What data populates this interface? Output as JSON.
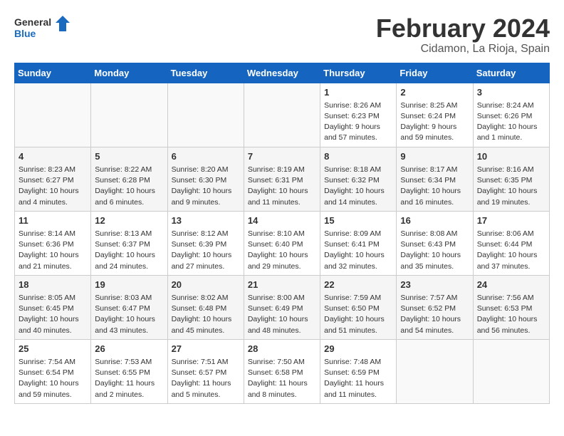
{
  "header": {
    "logo_general": "General",
    "logo_blue": "Blue",
    "month_title": "February 2024",
    "location": "Cidamon, La Rioja, Spain"
  },
  "weekdays": [
    "Sunday",
    "Monday",
    "Tuesday",
    "Wednesday",
    "Thursday",
    "Friday",
    "Saturday"
  ],
  "weeks": [
    [
      {
        "day": "",
        "info": ""
      },
      {
        "day": "",
        "info": ""
      },
      {
        "day": "",
        "info": ""
      },
      {
        "day": "",
        "info": ""
      },
      {
        "day": "1",
        "info": "Sunrise: 8:26 AM\nSunset: 6:23 PM\nDaylight: 9 hours\nand 57 minutes."
      },
      {
        "day": "2",
        "info": "Sunrise: 8:25 AM\nSunset: 6:24 PM\nDaylight: 9 hours\nand 59 minutes."
      },
      {
        "day": "3",
        "info": "Sunrise: 8:24 AM\nSunset: 6:26 PM\nDaylight: 10 hours\nand 1 minute."
      }
    ],
    [
      {
        "day": "4",
        "info": "Sunrise: 8:23 AM\nSunset: 6:27 PM\nDaylight: 10 hours\nand 4 minutes."
      },
      {
        "day": "5",
        "info": "Sunrise: 8:22 AM\nSunset: 6:28 PM\nDaylight: 10 hours\nand 6 minutes."
      },
      {
        "day": "6",
        "info": "Sunrise: 8:20 AM\nSunset: 6:30 PM\nDaylight: 10 hours\nand 9 minutes."
      },
      {
        "day": "7",
        "info": "Sunrise: 8:19 AM\nSunset: 6:31 PM\nDaylight: 10 hours\nand 11 minutes."
      },
      {
        "day": "8",
        "info": "Sunrise: 8:18 AM\nSunset: 6:32 PM\nDaylight: 10 hours\nand 14 minutes."
      },
      {
        "day": "9",
        "info": "Sunrise: 8:17 AM\nSunset: 6:34 PM\nDaylight: 10 hours\nand 16 minutes."
      },
      {
        "day": "10",
        "info": "Sunrise: 8:16 AM\nSunset: 6:35 PM\nDaylight: 10 hours\nand 19 minutes."
      }
    ],
    [
      {
        "day": "11",
        "info": "Sunrise: 8:14 AM\nSunset: 6:36 PM\nDaylight: 10 hours\nand 21 minutes."
      },
      {
        "day": "12",
        "info": "Sunrise: 8:13 AM\nSunset: 6:37 PM\nDaylight: 10 hours\nand 24 minutes."
      },
      {
        "day": "13",
        "info": "Sunrise: 8:12 AM\nSunset: 6:39 PM\nDaylight: 10 hours\nand 27 minutes."
      },
      {
        "day": "14",
        "info": "Sunrise: 8:10 AM\nSunset: 6:40 PM\nDaylight: 10 hours\nand 29 minutes."
      },
      {
        "day": "15",
        "info": "Sunrise: 8:09 AM\nSunset: 6:41 PM\nDaylight: 10 hours\nand 32 minutes."
      },
      {
        "day": "16",
        "info": "Sunrise: 8:08 AM\nSunset: 6:43 PM\nDaylight: 10 hours\nand 35 minutes."
      },
      {
        "day": "17",
        "info": "Sunrise: 8:06 AM\nSunset: 6:44 PM\nDaylight: 10 hours\nand 37 minutes."
      }
    ],
    [
      {
        "day": "18",
        "info": "Sunrise: 8:05 AM\nSunset: 6:45 PM\nDaylight: 10 hours\nand 40 minutes."
      },
      {
        "day": "19",
        "info": "Sunrise: 8:03 AM\nSunset: 6:47 PM\nDaylight: 10 hours\nand 43 minutes."
      },
      {
        "day": "20",
        "info": "Sunrise: 8:02 AM\nSunset: 6:48 PM\nDaylight: 10 hours\nand 45 minutes."
      },
      {
        "day": "21",
        "info": "Sunrise: 8:00 AM\nSunset: 6:49 PM\nDaylight: 10 hours\nand 48 minutes."
      },
      {
        "day": "22",
        "info": "Sunrise: 7:59 AM\nSunset: 6:50 PM\nDaylight: 10 hours\nand 51 minutes."
      },
      {
        "day": "23",
        "info": "Sunrise: 7:57 AM\nSunset: 6:52 PM\nDaylight: 10 hours\nand 54 minutes."
      },
      {
        "day": "24",
        "info": "Sunrise: 7:56 AM\nSunset: 6:53 PM\nDaylight: 10 hours\nand 56 minutes."
      }
    ],
    [
      {
        "day": "25",
        "info": "Sunrise: 7:54 AM\nSunset: 6:54 PM\nDaylight: 10 hours\nand 59 minutes."
      },
      {
        "day": "26",
        "info": "Sunrise: 7:53 AM\nSunset: 6:55 PM\nDaylight: 11 hours\nand 2 minutes."
      },
      {
        "day": "27",
        "info": "Sunrise: 7:51 AM\nSunset: 6:57 PM\nDaylight: 11 hours\nand 5 minutes."
      },
      {
        "day": "28",
        "info": "Sunrise: 7:50 AM\nSunset: 6:58 PM\nDaylight: 11 hours\nand 8 minutes."
      },
      {
        "day": "29",
        "info": "Sunrise: 7:48 AM\nSunset: 6:59 PM\nDaylight: 11 hours\nand 11 minutes."
      },
      {
        "day": "",
        "info": ""
      },
      {
        "day": "",
        "info": ""
      }
    ]
  ]
}
